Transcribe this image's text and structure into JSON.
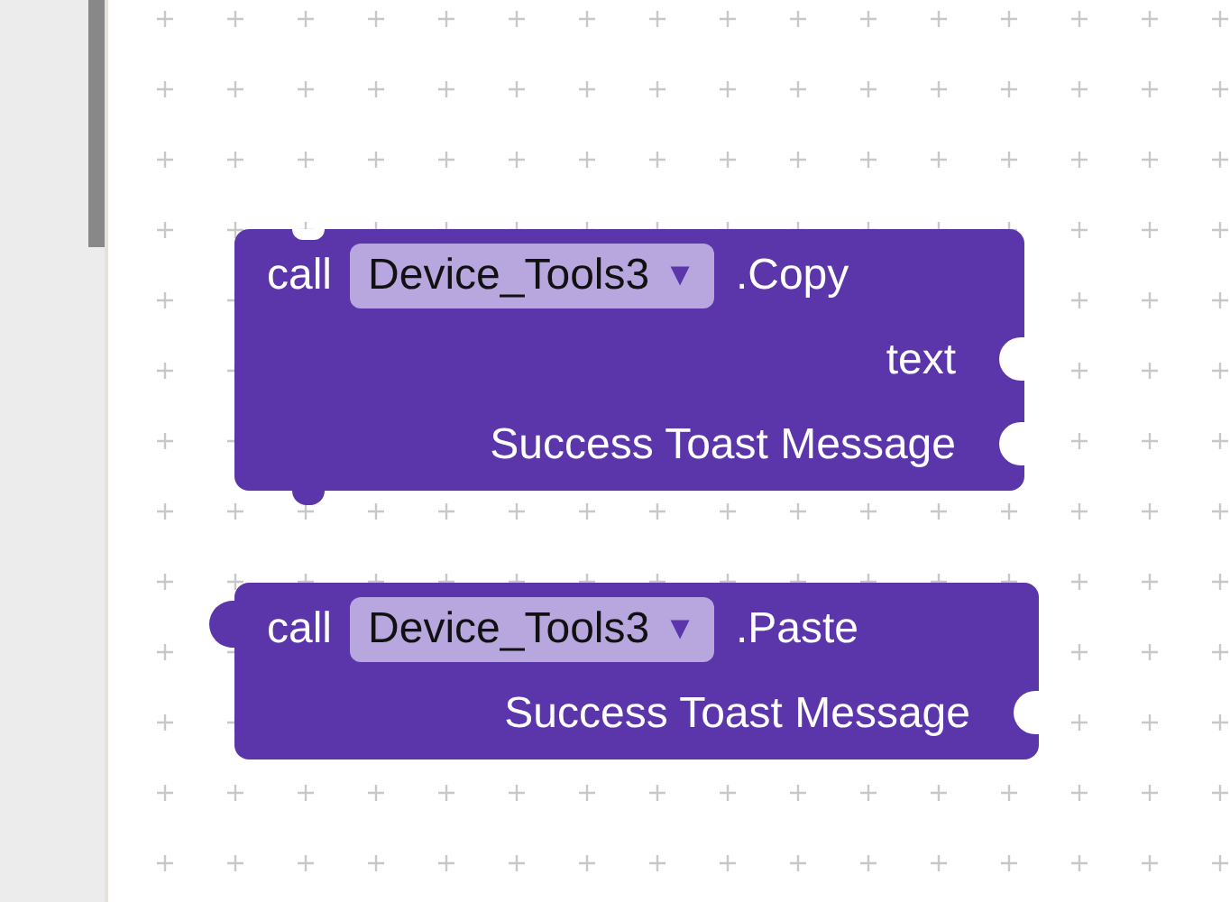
{
  "blocks": [
    {
      "kind": "statement",
      "keyword": "call",
      "component": "Device_Tools3",
      "dropdown_arrow": "▼",
      "method": ".Copy",
      "params": [
        "text",
        "Success Toast Message"
      ]
    },
    {
      "kind": "value",
      "keyword": "call",
      "component": "Device_Tools3",
      "dropdown_arrow": "▼",
      "method": ".Paste",
      "params": [
        "Success Toast Message"
      ]
    }
  ]
}
